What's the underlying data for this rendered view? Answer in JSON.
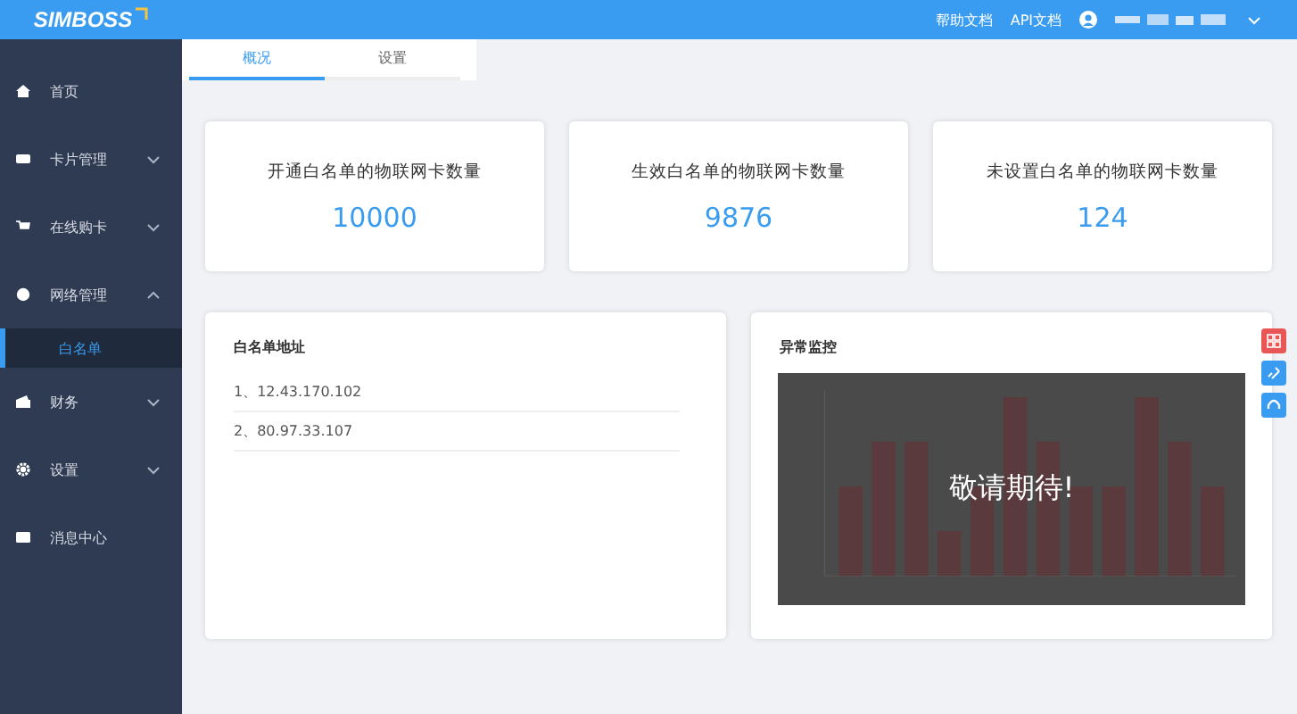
{
  "header": {
    "logo": "SIMBOSS",
    "links": [
      "帮助文档",
      "API文档"
    ]
  },
  "tabs": [
    {
      "label": "概况",
      "selected": true
    },
    {
      "label": "设置",
      "selected": false
    }
  ],
  "sidebar": {
    "items": [
      {
        "label": "首页",
        "kind": "link"
      },
      {
        "label": "卡片管理",
        "kind": "group",
        "expanded": false
      },
      {
        "label": "在线购卡",
        "kind": "group",
        "expanded": false
      },
      {
        "label": "网络管理",
        "kind": "group",
        "expanded": true,
        "children": [
          {
            "label": "白名单",
            "selected": true
          }
        ]
      },
      {
        "label": "财务",
        "kind": "group",
        "expanded": false
      },
      {
        "label": "设置",
        "kind": "group",
        "expanded": false
      },
      {
        "label": "消息中心",
        "kind": "link"
      }
    ]
  },
  "stats": [
    {
      "label": "开通白名单的物联网卡数量",
      "value": "10000"
    },
    {
      "label": "生效白名单的物联网卡数量",
      "value": "9876"
    },
    {
      "label": "未设置白名单的物联网卡数量",
      "value": "124"
    }
  ],
  "whitelist": {
    "title": "白名单地址",
    "rows": [
      "1、12.43.170.102",
      "2、80.97.33.107"
    ]
  },
  "monitor": {
    "title": "异常监控",
    "overlay": "敬请期待!"
  }
}
